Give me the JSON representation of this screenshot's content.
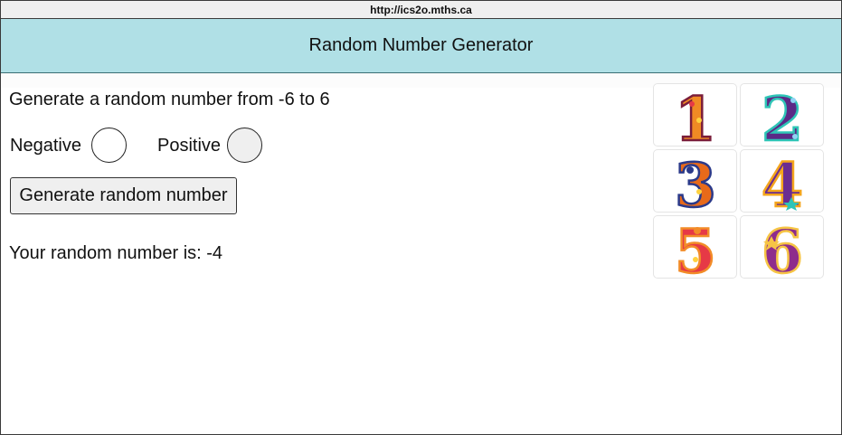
{
  "browser": {
    "url": "http://ics2o.mths.ca"
  },
  "header": {
    "title": "Random Number Generator"
  },
  "main": {
    "instruction": "Generate a random number from -6 to 6",
    "negative_label": "Negative",
    "positive_label": "Positive",
    "generate_button": "Generate random number",
    "result_prefix": "Your random number is: ",
    "result_value": "-4"
  },
  "dice_images": [
    {
      "digit": "1",
      "colors": [
        "#f08a24",
        "#e63946"
      ]
    },
    {
      "digit": "2",
      "colors": [
        "#5b2a86",
        "#2ec4b6"
      ]
    },
    {
      "digit": "3",
      "colors": [
        "#e86a1a",
        "#2b3a8a"
      ]
    },
    {
      "digit": "4",
      "colors": [
        "#6a2c91",
        "#f4a51c"
      ]
    },
    {
      "digit": "5",
      "colors": [
        "#e63946",
        "#f28c28"
      ]
    },
    {
      "digit": "6",
      "colors": [
        "#8e2c8c",
        "#f6c445"
      ]
    }
  ],
  "colors": {
    "header_bg": "#b0e0e6",
    "button_bg": "#efefef"
  }
}
